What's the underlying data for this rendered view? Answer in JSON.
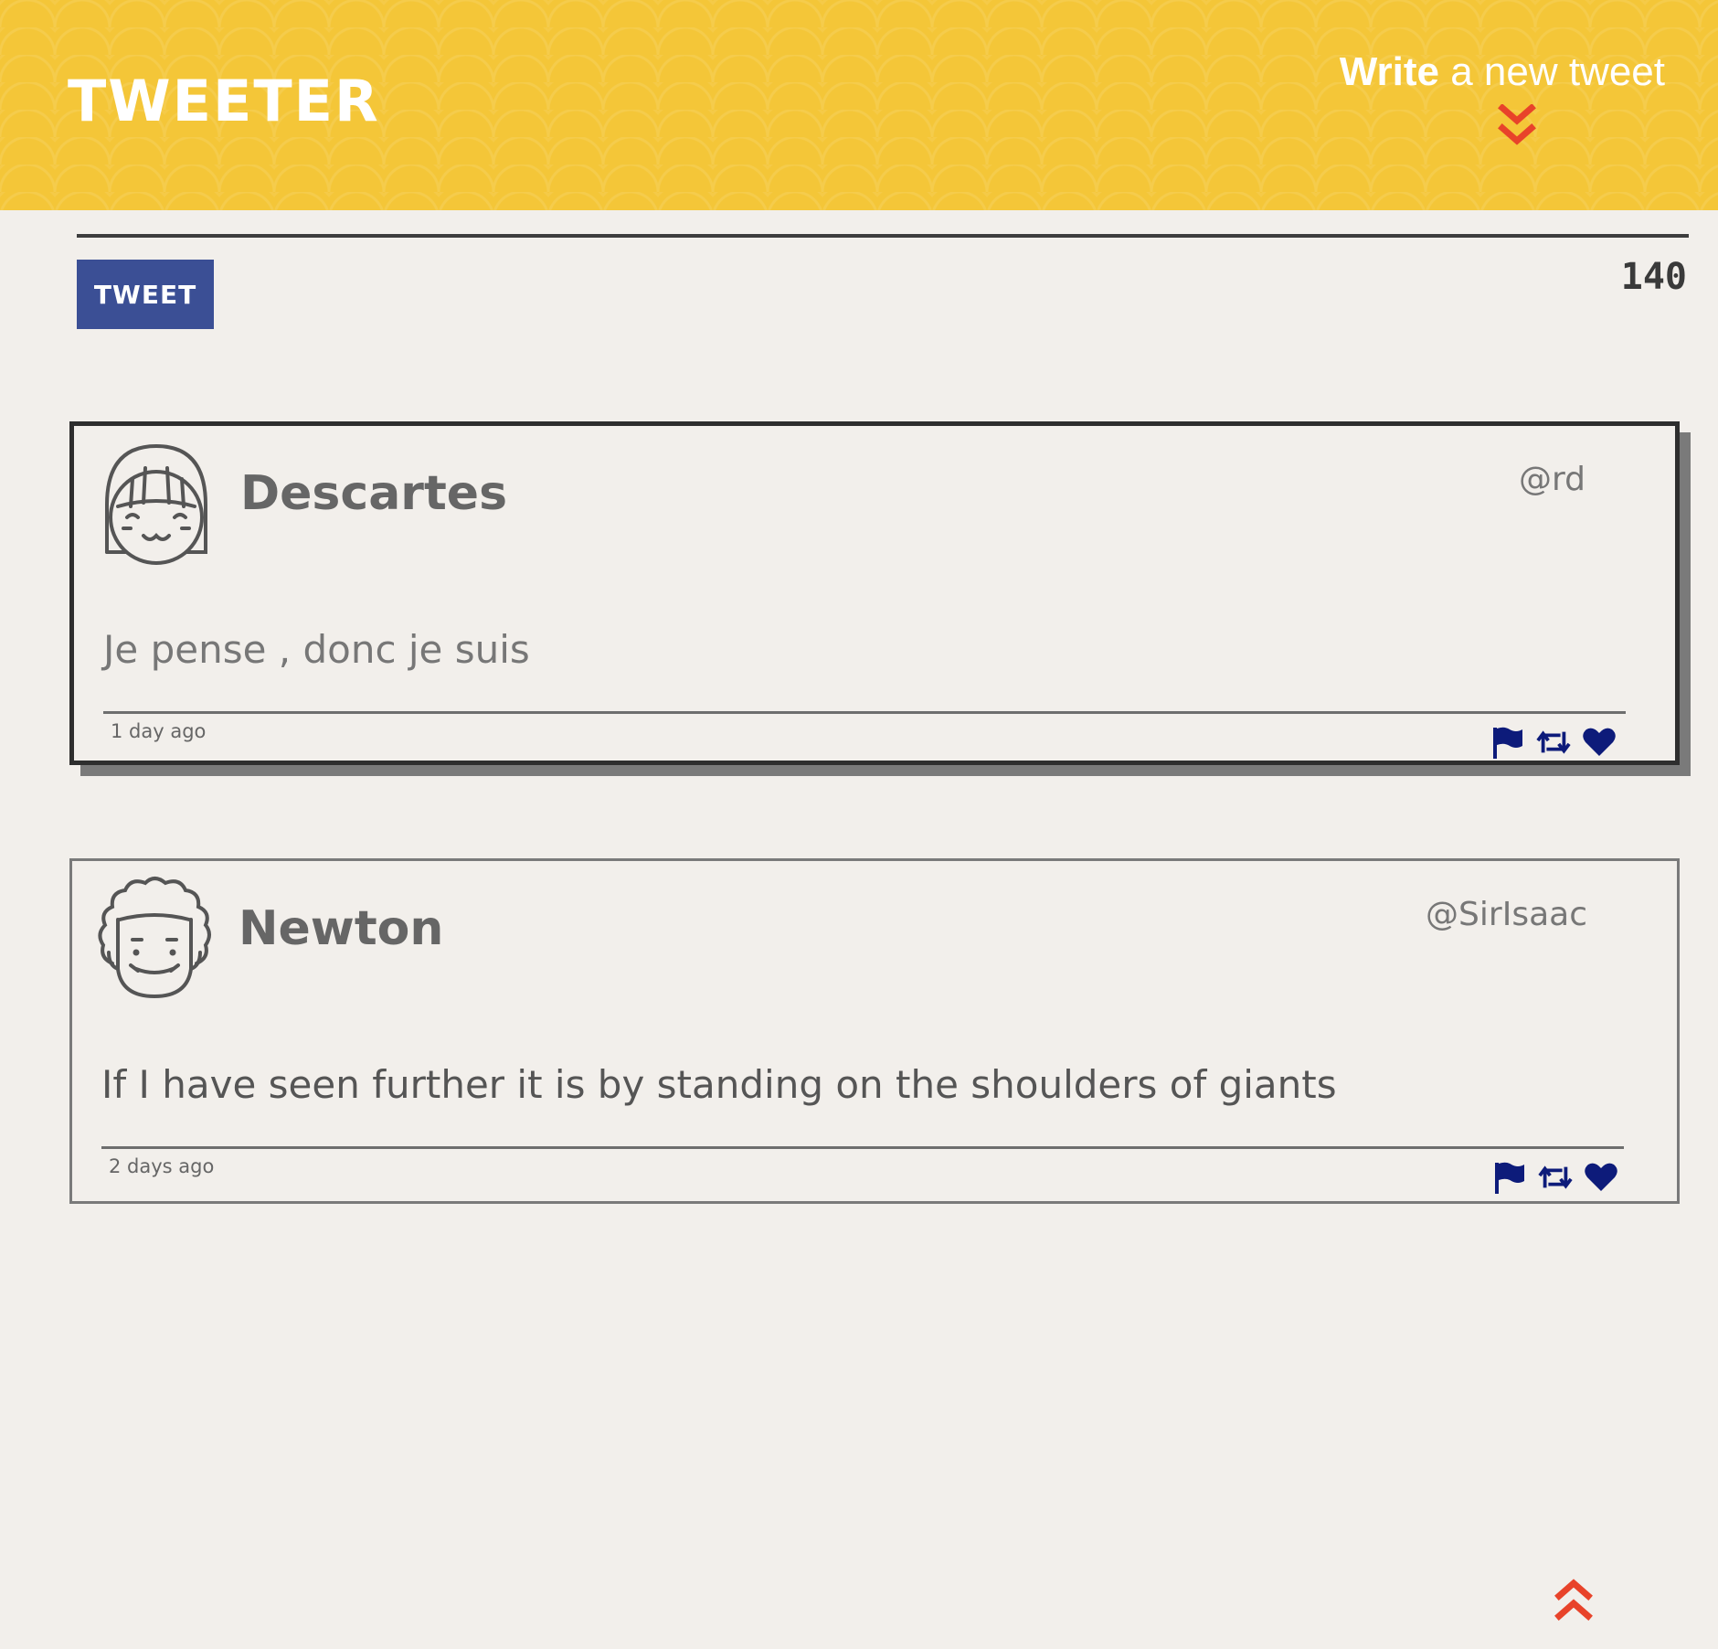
{
  "header": {
    "logo": "TWEETER",
    "compose_toggle_bold": "Write",
    "compose_toggle_rest": " a new tweet",
    "compose_toggle_icon": "double-chevron-down-icon",
    "background_color": "#f4c638"
  },
  "composer": {
    "tweet_button_label": "TWEET",
    "char_counter": "140",
    "button_color": "#3b4f95"
  },
  "tweets": [
    {
      "avatar_icon": "girl-avatar-icon",
      "name": "Descartes",
      "handle": "@rd",
      "text": "Je pense , donc je suis",
      "timestamp": "1 day ago",
      "actions": [
        "flag-icon",
        "retweet-icon",
        "heart-icon"
      ]
    },
    {
      "avatar_icon": "curly-hair-avatar-icon",
      "name": "Newton",
      "handle": "@SirIsaac",
      "text": "If I have seen further it is by standing on the shoulders of giants",
      "timestamp": "2 days ago",
      "actions": [
        "flag-icon",
        "retweet-icon",
        "heart-icon"
      ]
    }
  ],
  "footer": {
    "back_to_top_icon": "double-chevron-up-icon",
    "accent_color": "#e8432a",
    "icon_color": "#0d1b7a"
  }
}
